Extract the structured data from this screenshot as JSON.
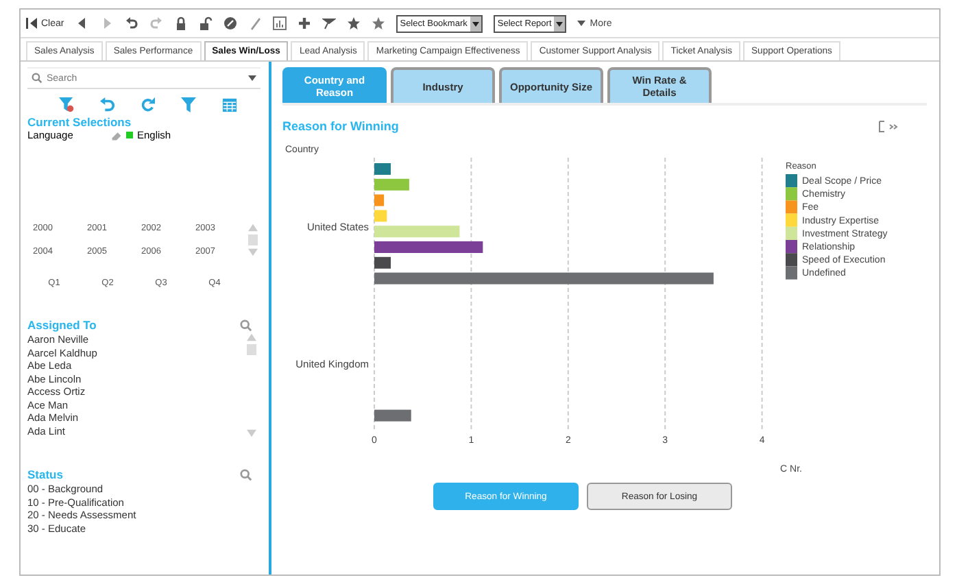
{
  "toolbar": {
    "clear_label": "Clear",
    "bookmark_select": "Select Bookmark",
    "report_select": "Select Report",
    "more_label": "More"
  },
  "sheet_tabs": [
    {
      "label": "Sales Analysis",
      "selected": false
    },
    {
      "label": "Sales Performance",
      "selected": false
    },
    {
      "label": "Sales Win/Loss",
      "selected": true
    },
    {
      "label": "Lead Analysis",
      "selected": false
    },
    {
      "label": "Marketing Campaign Effectiveness",
      "selected": false
    },
    {
      "label": "Customer Support Analysis",
      "selected": false
    },
    {
      "label": "Ticket Analysis",
      "selected": false
    },
    {
      "label": "Support Operations",
      "selected": false
    }
  ],
  "sidebar": {
    "search": {
      "placeholder": "Search"
    },
    "current_selections": {
      "title": "Current Selections",
      "field": "Language",
      "value": "English"
    },
    "years": [
      "2000",
      "2001",
      "2002",
      "2003",
      "2004",
      "2005",
      "2006",
      "2007"
    ],
    "quarters": [
      "Q1",
      "Q2",
      "Q3",
      "Q4"
    ],
    "assigned_to": {
      "title": "Assigned To",
      "items": [
        "Aaron Neville",
        "Aarcel Kaldhup",
        "Abe Leda",
        "Abe Lincoln",
        "Access Ortiz",
        "Ace Man",
        "Ada Melvin",
        "Ada Lint"
      ]
    },
    "status": {
      "title": "Status",
      "items": [
        "00 - Background",
        "10 - Pre-Qualification",
        "20 - Needs Assessment",
        "30 - Educate"
      ]
    }
  },
  "view_tabs": [
    {
      "label": "Country and Reason",
      "selected": true
    },
    {
      "label": "Industry",
      "selected": false
    },
    {
      "label": "Opportunity Size",
      "selected": false
    },
    {
      "label": "Win Rate & Details",
      "selected": false
    }
  ],
  "chart_title": "Reason for Winning",
  "chart_data": {
    "type": "bar",
    "orientation": "horizontal",
    "ylabel": "Country",
    "xlabel": "C Nr.",
    "legend_title": "Reason",
    "grid": true,
    "legend": true,
    "categories": [
      "United States",
      "United Kingdom"
    ],
    "xticks": [
      0,
      1,
      2,
      3,
      4
    ],
    "xlim": [
      0,
      4
    ],
    "series": [
      {
        "name": "Deal Scope / Price",
        "color": "#1f7f8c",
        "values": [
          0.17,
          null
        ]
      },
      {
        "name": "Chemistry",
        "color": "#8dc63f",
        "values": [
          0.36,
          null
        ]
      },
      {
        "name": "Fee",
        "color": "#f7941d",
        "values": [
          0.1,
          null
        ]
      },
      {
        "name": "Industry Expertise",
        "color": "#ffd93b",
        "values": [
          0.13,
          null
        ]
      },
      {
        "name": "Investment Strategy",
        "color": "#cfe59a",
        "values": [
          0.88,
          null
        ]
      },
      {
        "name": "Relationship",
        "color": "#7b3f98",
        "values": [
          1.12,
          null
        ]
      },
      {
        "name": "Speed of Execution",
        "color": "#4a4a4c",
        "values": [
          0.17,
          null
        ]
      },
      {
        "name": "Undefined",
        "color": "#6d6e71",
        "values": [
          3.5,
          0.38
        ]
      }
    ]
  },
  "reason_buttons": [
    {
      "label": "Reason for Winning",
      "selected": true
    },
    {
      "label": "Reason for Losing",
      "selected": false
    }
  ]
}
